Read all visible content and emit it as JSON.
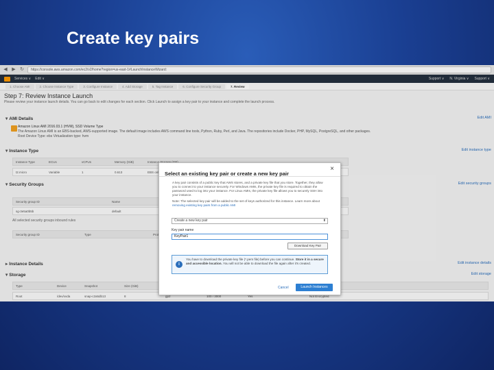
{
  "slide": {
    "title": "Create key pairs"
  },
  "browser": {
    "url": "https://console.aws.amazon.com/ec2/v2/home?region=us-east-1#LaunchInstanceWizard:",
    "nav": {
      "back": "◀",
      "forward": "▶",
      "reload": "↻"
    }
  },
  "aws_nav": {
    "services": "Services ∨",
    "edit": "Edit ∨",
    "right_items": [
      "Support ∨",
      "N. Virginia ∨",
      "Support ∨"
    ]
  },
  "wizard_steps": [
    "1. Choose AMI",
    "2. Choose Instance Type",
    "3. Configure Instance",
    "4. Add Storage",
    "5. Tag Instance",
    "6. Configure Security Group",
    "7. Review"
  ],
  "page": {
    "heading": "Step 7: Review Instance Launch",
    "subtitle": "Please review your instance launch details. You can go back to edit changes for each section. Click Launch to assign a key pair to your instance and complete the launch process."
  },
  "sections": {
    "ami": {
      "label": "AMI Details",
      "edit": "Edit AMI",
      "name": "Amazon Linux AMI 2016.03.1 (HVM), SSD Volume Type",
      "desc": "The Amazon Linux AMI is an EBS-backed, AWS-supported image. The default image includes AWS command line tools, Python, Ruby, Perl, and Java. The repositories include Docker, PHP, MySQL, PostgreSQL, and other packages.",
      "root": "Root Device Type: ebs   Virtualization type: hvm"
    },
    "instance_type": {
      "label": "Instance Type",
      "edit": "Edit instance type",
      "columns": [
        "Instance Type",
        "ECUs",
        "vCPUs",
        "Memory (GiB)",
        "Instance Storage (GB)"
      ],
      "row": [
        "t2.micro",
        "Variable",
        "1",
        "0.613",
        "EBS only"
      ]
    },
    "security_groups": {
      "label": "Security Groups",
      "edit": "Edit security groups",
      "columns": [
        "Security group ID",
        "Name",
        "Description"
      ],
      "row": [
        "sg-3e5a0b5b",
        "default",
        "default VPC security group"
      ],
      "note": "All selected security groups inbound rules",
      "rule_columns": [
        "Security group ID",
        "Type",
        "Protocol",
        "Port Range",
        "Source"
      ]
    },
    "instance_details": {
      "label": "Instance Details",
      "edit": "Edit instance details"
    },
    "storage": {
      "label": "Storage",
      "edit": "Edit storage",
      "columns": [
        "Type",
        "Device",
        "Snapshot",
        "Size (GiB)",
        "Volume Type",
        "IOPS",
        "Delete on Termination",
        "Encrypted"
      ],
      "row": [
        "Root",
        "/dev/xvda",
        "snap-c2a5db13",
        "8",
        "gp2",
        "100 / 3000",
        "Yes",
        "Not Encrypted"
      ]
    }
  },
  "modal": {
    "title": "Select an existing key pair or create a new key pair",
    "close": "×",
    "para1": "A key pair consists of a public key that AWS stores, and a private key file that you store. Together, they allow you to connect to your instance securely. For Windows AMIs, the private key file is required to obtain the password used to log into your instance. For Linux AMIs, the private key file allows you to securely SSH into your instance.",
    "para2_prefix": "Note: The selected key pair will be added to the set of keys authorized for this instance. Learn more about ",
    "para2_link": "removing existing key pairs from a public AMI",
    "select_value": "Create a new key pair",
    "select_arrow": "⬍",
    "keypair_label": "Key pair name",
    "keypair_value": "KeyPair1",
    "download_button": "Download Key Pair",
    "info_icon": "i",
    "info_text_1": "You have to download the private key file (*.pem file) before you can continue.",
    "info_text_2": "Store it in a secure and accessible location.",
    "info_text_3": " You will not be able to download the file again after it's created.",
    "cancel": "Cancel",
    "launch": "Launch Instances"
  },
  "colors": {
    "background": "#1a3f92",
    "accent": "#2d7fd2",
    "aws_bar": "#232f3e"
  }
}
